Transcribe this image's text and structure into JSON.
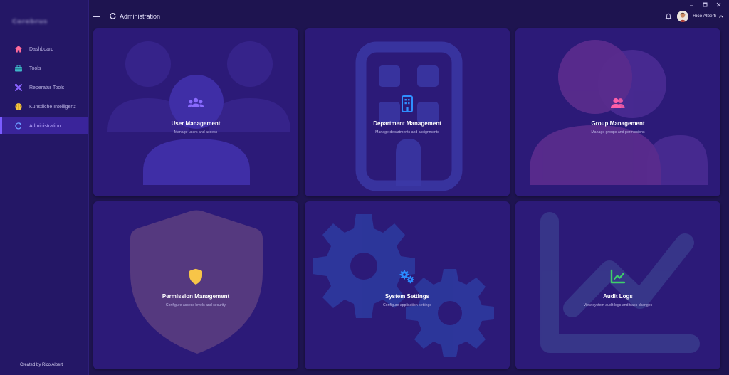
{
  "sidebar": {
    "logo_text": "Cerebrus",
    "items": [
      {
        "label": "Dashboard",
        "icon": "home-icon",
        "color": "#ff6b9a"
      },
      {
        "label": "Tools",
        "icon": "toolbox-icon",
        "color": "#3fb6c9"
      },
      {
        "label": "Reperatur Tools",
        "icon": "wrench-screwdriver-icon",
        "color": "#8a63ff"
      },
      {
        "label": "Künstliche Intelligenz",
        "icon": "brain-icon",
        "color": "#f5c542"
      },
      {
        "label": "Administration",
        "icon": "admin-refresh-icon",
        "color": "#6b9bff",
        "active": true
      }
    ],
    "footer": "Created by Rico Alberti"
  },
  "topbar": {
    "title": "Administration",
    "user_name": "Rico Alberti"
  },
  "cards": [
    {
      "title": "User Management",
      "desc": "Manage users and access",
      "icon": "users-icon",
      "color": "#8a6bff"
    },
    {
      "title": "Department Management",
      "desc": "Manage departments and assignments",
      "icon": "building-icon",
      "color": "#2f8fff"
    },
    {
      "title": "Group Management",
      "desc": "Manage groups and permissions",
      "icon": "user-group-icon",
      "color": "#ff5fa8"
    },
    {
      "title": "Permission Management",
      "desc": "Configure access levels and security",
      "icon": "shield-icon",
      "color": "#f7c548"
    },
    {
      "title": "System Settings",
      "desc": "Configure application settings",
      "icon": "gears-icon",
      "color": "#2b8cff"
    },
    {
      "title": "Audit Logs",
      "desc": "View system audit logs and track changes",
      "icon": "chart-line-icon",
      "color": "#3fcf6a"
    }
  ]
}
